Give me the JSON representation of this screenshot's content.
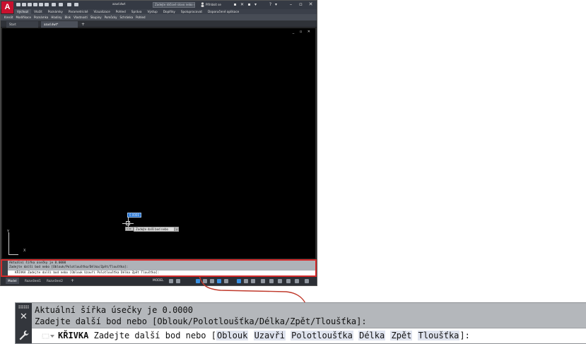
{
  "app": {
    "logo": "A",
    "doc_title": "azud.dwt",
    "search_placeholder": "Zadejte klíčové slovo nebo výraz",
    "user": "Přihlásit se",
    "tabs": [
      "Výchozí",
      "Vložit",
      "Poznámky",
      "Parametrické",
      "Vizualizace",
      "Pohled",
      "Správa",
      "Výstup",
      "Doplňky",
      "Spolupracovat",
      "Doporučené aplikace"
    ],
    "active_tab": "Výchozí",
    "panels": [
      "Kreslit",
      "Modifikace",
      "Poznámka",
      "Hladiny",
      "Blok",
      "Vlastnosti",
      "Skupiny",
      "Pomůcky",
      "Schránka",
      "Pohled"
    ],
    "file_tabs": [
      "Start",
      "azud.dwt*"
    ],
    "file_tab_add": "+",
    "viewport_buttons": "_ ▫ ✕",
    "ucs_y": "Y",
    "ucs_x": "X"
  },
  "canvas": {
    "dynamic_input_value": "0.0000",
    "tooltip_small": "0.00",
    "tooltip_prompt": "Zadejte další bod nebo",
    "tooltip_dropdown": "↓"
  },
  "command_small": {
    "history_1": "Aktuální šířka úsečky je 0.0000",
    "history_2": "Zadejte další bod nebo [Oblouk/Polotloušťka/Délka/Zpět/Tloušťka]:",
    "input": "KŘIVKA Zadejte další bod nebo [Oblouk Uzavři Polotloušťka Délka Zpět Tloušťka]:"
  },
  "statusbar": {
    "layout_tabs": [
      "Model",
      "Rozvržení1",
      "Rozvržení2"
    ],
    "layout_add": "+",
    "model_label": "MODEL"
  },
  "command_zoom": {
    "history_1": "Aktuální šířka úsečky je 0.0000",
    "history_2": "Zadejte další bod nebo [Oblouk/Polotloušťka/Délka/Zpět/Tloušťka]:",
    "command_name": "KŘIVKA",
    "prompt": "Zadejte další bod nebo [",
    "options": [
      "Oblouk",
      "Uzavři",
      "Polotloušťka",
      "Délka",
      "Zpět",
      "Tloušťka"
    ],
    "prompt_end": "]:"
  },
  "colors": {
    "highlight_border": "#d52b2b",
    "canvas_bg": "#000000",
    "option_highlight": "#dfe3ee"
  }
}
